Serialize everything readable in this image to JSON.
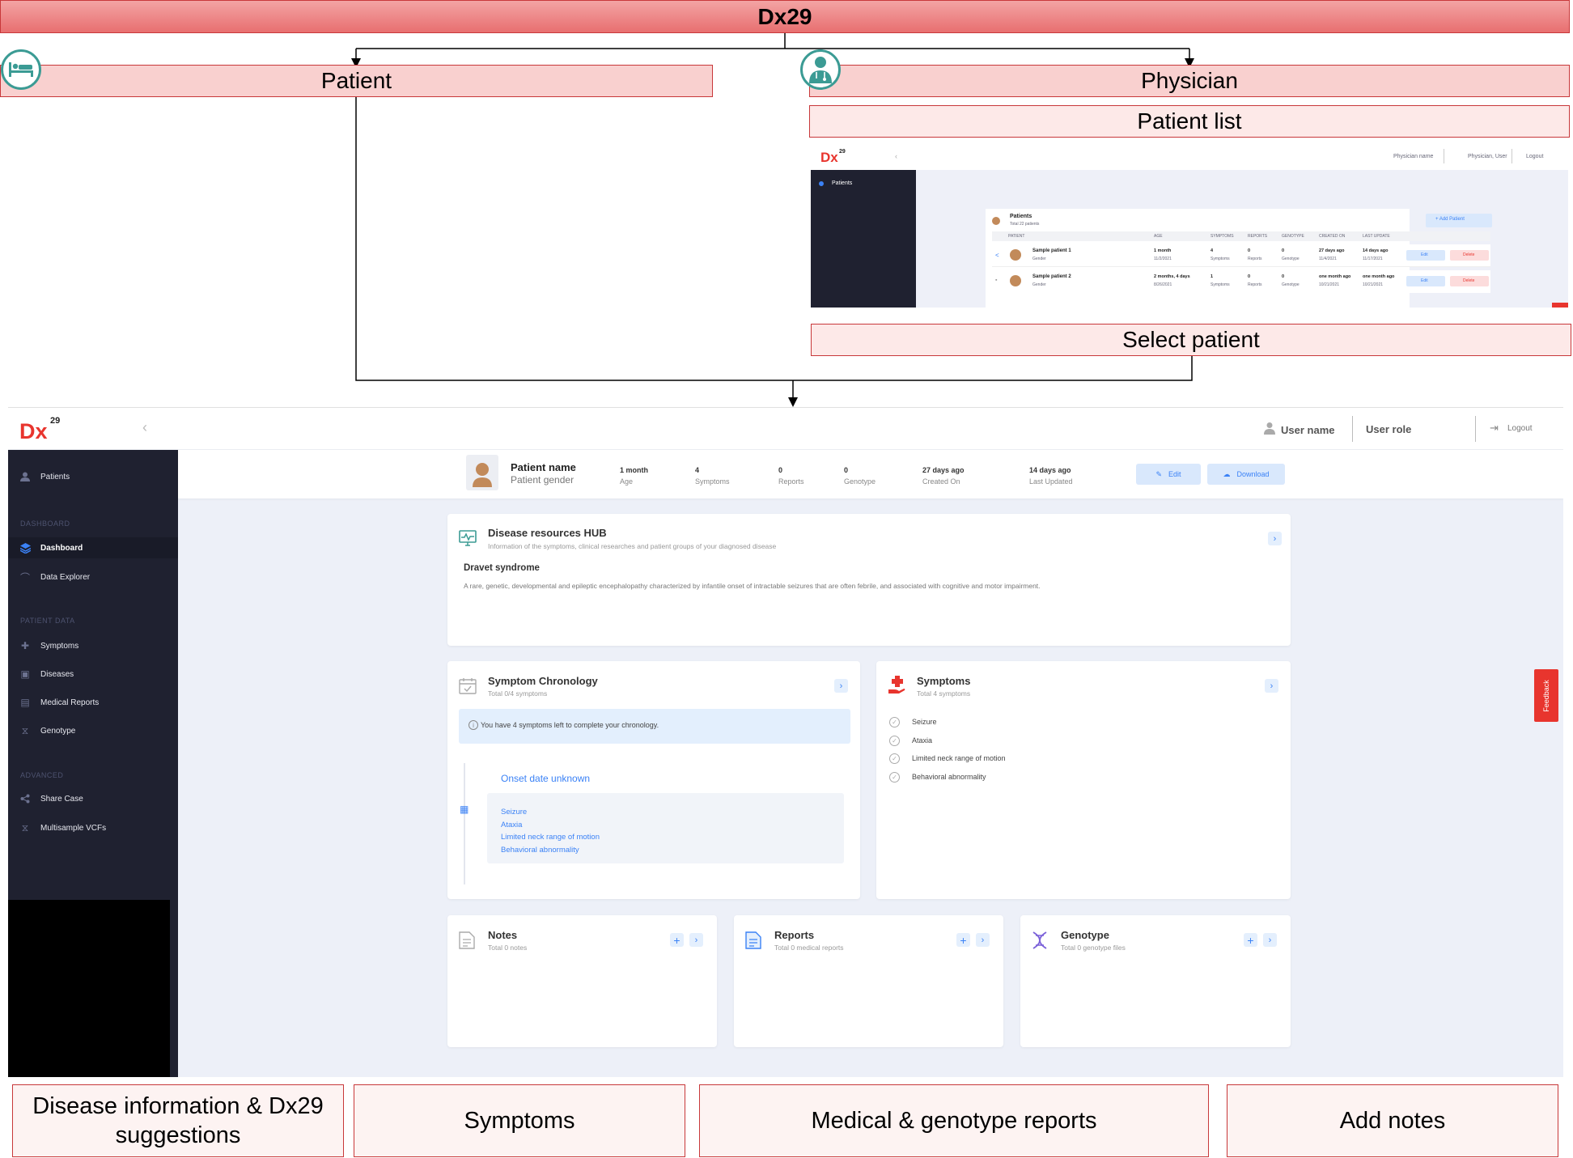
{
  "diagram": {
    "top": "Dx29",
    "patient": "Patient",
    "physician": "Physician",
    "patient_list": "Patient list",
    "select_patient": "Select patient",
    "bottom": [
      "Disease information & Dx29 suggestions",
      "Symptoms",
      "Medical & genotype reports",
      "Add notes"
    ]
  },
  "patient_list_screen": {
    "logo": "Dx",
    "logo_sup": "29",
    "user": "Physician name",
    "role": "Physician, User",
    "logout": "Logout",
    "nav": "Patients",
    "title": "Patients",
    "subtitle": "Total 22 patients",
    "add_button": "+ Add Patient",
    "columns": [
      "PATIENT",
      "AGE",
      "SYMPTOMS",
      "REPORTS",
      "GENOTYPE",
      "CREATED ON",
      "LAST UPDATE"
    ],
    "rows": [
      {
        "name": "Sample patient 1",
        "gender": "Gender",
        "age": "1 month",
        "age_date": "11/2/2021",
        "symptoms": "4",
        "reports": "0",
        "genotype": "0",
        "created": "27 days ago",
        "created_date": "11/4/2021",
        "updated": "14 days ago",
        "updated_date": "11/17/2021"
      },
      {
        "name": "Sample patient 2",
        "gender": "Gender",
        "age": "2 months, 4 days",
        "age_date": "8/26/2021",
        "symptoms": "1",
        "reports": "0",
        "genotype": "0",
        "created": "one month ago",
        "created_date": "10/21/2021",
        "updated": "one month ago",
        "updated_date": "10/21/2021"
      }
    ],
    "row_labels": {
      "symptoms": "Symptoms",
      "reports": "Reports",
      "genotype": "Genotype"
    },
    "edit": "Edit",
    "delete": "Delete"
  },
  "app": {
    "logo": "Dx",
    "logo_sup": "29",
    "user_name": "User name",
    "user_role": "User role",
    "logout": "Logout",
    "sidebar": {
      "patients": "Patients",
      "dashboard_section": "DASHBOARD",
      "dashboard": "Dashboard",
      "data_explorer": "Data Explorer",
      "patient_data_section": "PATIENT DATA",
      "symptoms": "Symptoms",
      "diseases": "Diseases",
      "medical_reports": "Medical Reports",
      "genotype": "Genotype",
      "advanced_section": "ADVANCED",
      "share_case": "Share Case",
      "multisample": "Multisample VCFs"
    },
    "patient_header": {
      "name": "Patient name",
      "gender": "Patient gender",
      "stats": [
        {
          "value": "1 month",
          "label": "Age"
        },
        {
          "value": "4",
          "label": "Symptoms"
        },
        {
          "value": "0",
          "label": "Reports"
        },
        {
          "value": "0",
          "label": "Genotype"
        },
        {
          "value": "27 days ago",
          "label": "Created On"
        },
        {
          "value": "14 days ago",
          "label": "Last Updated"
        }
      ],
      "edit": "Edit",
      "download": "Download"
    },
    "hub": {
      "title": "Disease resources HUB",
      "subtitle": "Information of the symptoms, clinical researches and patient groups of your diagnosed disease",
      "disease": "Dravet syndrome",
      "description": "A rare, genetic, developmental and epileptic encephalopathy characterized by infantile onset of intractable seizures that are often febrile, and associated with cognitive and motor impairment."
    },
    "chronology": {
      "title": "Symptom Chronology",
      "subtitle": "Total 0/4 symptoms",
      "alert": "You have 4 symptoms left to complete your chronology.",
      "onset": "Onset date unknown",
      "items": [
        "Seizure",
        "Ataxia",
        "Limited neck range of motion",
        "Behavioral abnormality"
      ]
    },
    "symptoms": {
      "title": "Symptoms",
      "subtitle": "Total 4 symptoms",
      "items": [
        "Seizure",
        "Ataxia",
        "Limited neck range of motion",
        "Behavioral abnormality"
      ]
    },
    "notes": {
      "title": "Notes",
      "subtitle": "Total 0 notes"
    },
    "reports": {
      "title": "Reports",
      "subtitle": "Total 0 medical reports"
    },
    "genotype": {
      "title": "Genotype",
      "subtitle": "Total 0 genotype files"
    },
    "feedback": "Feedback",
    "colors": {
      "brand": "#e8352e",
      "sidebar": "#1f2130",
      "accent": "#3b82f6"
    }
  }
}
